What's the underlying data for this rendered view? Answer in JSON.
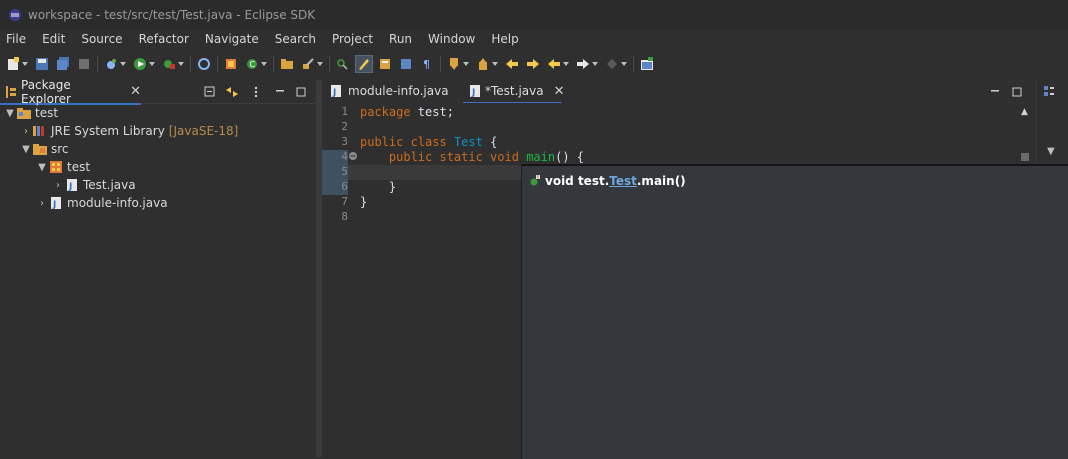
{
  "window": {
    "title": "workspace - test/src/test/Test.java - Eclipse SDK"
  },
  "menu": [
    "File",
    "Edit",
    "Source",
    "Refactor",
    "Navigate",
    "Search",
    "Project",
    "Run",
    "Window",
    "Help"
  ],
  "package_explorer": {
    "tab_label": "Package Explorer",
    "tree": [
      {
        "label": "test",
        "expanded": true
      },
      {
        "label": "JRE System Library",
        "decoration": "[JavaSE-18]",
        "expanded": false
      },
      {
        "label": "src",
        "expanded": true
      },
      {
        "label": "test",
        "expanded": true
      },
      {
        "label": "Test.java",
        "expanded": false
      },
      {
        "label": "module-info.java",
        "expanded": false
      }
    ]
  },
  "editor": {
    "tabs": [
      {
        "label": "module-info.java",
        "active": false
      },
      {
        "label": "*Test.java",
        "active": true
      }
    ],
    "line_numbers": [
      "1",
      "2",
      "3",
      "4",
      "5",
      "6",
      "7",
      "8"
    ],
    "code": {
      "l1_kw": "package",
      "l1_rest": " test;",
      "l3_kw": "public class",
      "l3_type": "Test",
      "l3_rest": " {",
      "l4_kw": "public static void",
      "l4_method": "main",
      "l4_rest": "() {",
      "l6": "}",
      "l7": "}"
    }
  },
  "hover": {
    "prefix": "void test.",
    "link": "Test",
    "suffix": ".main()"
  },
  "colors": {
    "accent": "#3a70c3",
    "keyword": "#cc6c1d",
    "type": "#1290c3",
    "method": "#1eb540"
  }
}
